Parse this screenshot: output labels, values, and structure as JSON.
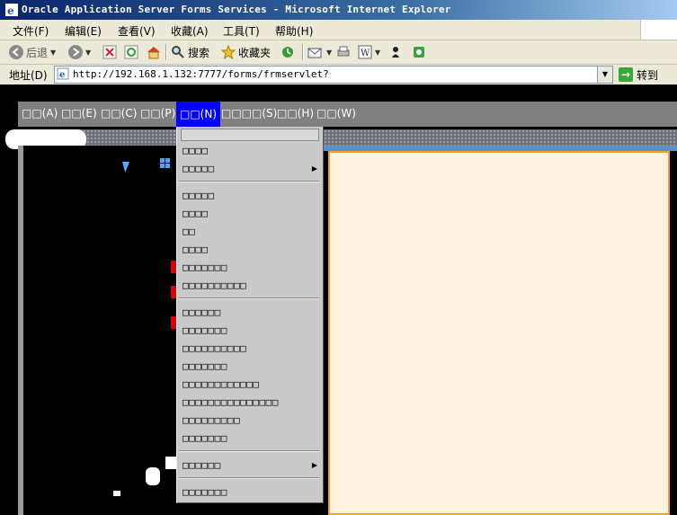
{
  "window": {
    "title": "Oracle Application Server Forms Services - Microsoft Internet Explorer"
  },
  "menubar": {
    "items": [
      "文件(F)",
      "编辑(E)",
      "查看(V)",
      "收藏(A)",
      "工具(T)",
      "帮助(H)"
    ]
  },
  "toolbar": {
    "back": "后退",
    "search": "搜索",
    "favorites": "收藏夹"
  },
  "address": {
    "label": "地址(D)",
    "url": "http://192.168.1.132:7777/forms/frmservlet?",
    "go": "转到"
  },
  "forms_menu": {
    "items": [
      "□□(A)",
      "□□(E)",
      "□□(C)",
      "□□(P)",
      "□□(N)",
      "□□□□(S)",
      "□□(H)",
      "□□(W)"
    ],
    "active_index": 4
  },
  "dropdown": {
    "items": [
      {
        "label": "□□□□",
        "submenu": false
      },
      {
        "label": "□□□□□",
        "submenu": true
      },
      {
        "label": "□□□□□",
        "submenu": false
      },
      {
        "label": "□□□□",
        "submenu": false
      },
      {
        "label": "□□",
        "submenu": false
      },
      {
        "label": "□□□□",
        "submenu": false
      },
      {
        "label": "□□□□□□□",
        "submenu": false
      },
      {
        "label": "□□□□□□□□□□",
        "submenu": false
      },
      {
        "label": "□□□□□□",
        "submenu": false
      },
      {
        "label": "□□□□□□□",
        "submenu": false
      },
      {
        "label": "□□□□□□□□□□",
        "submenu": false
      },
      {
        "label": "□□□□□□□",
        "submenu": false
      },
      {
        "label": "□□□□□□□□□□□□",
        "submenu": false
      },
      {
        "label": "□□□□□□□□□□□□□□□",
        "submenu": false
      },
      {
        "label": "□□□□□□□□□",
        "submenu": false
      },
      {
        "label": "□□□□□□□",
        "submenu": false
      },
      {
        "label": "□□□□□□",
        "submenu": true
      },
      {
        "label": "□□□□□□□",
        "submenu": false
      }
    ]
  },
  "colors": {
    "active_menu": "#0000ff",
    "right_panel": "#fff3e1",
    "right_panel_border": "#f0a030"
  }
}
